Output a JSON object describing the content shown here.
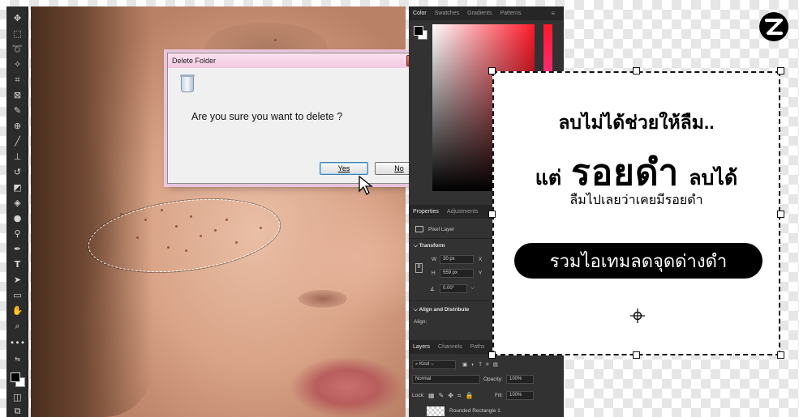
{
  "dialog": {
    "title": "Delete Folder",
    "close": "x",
    "message": "Are you sure you want to delete ?",
    "yes": "Yes",
    "no": "No"
  },
  "color_panel": {
    "tabs": [
      "Color",
      "Swatches",
      "Gradients",
      "Patterns"
    ],
    "menu": "≡"
  },
  "properties_panel": {
    "tabs": [
      "Properties",
      "Adjustments"
    ],
    "layer_type": "Pixel Layer",
    "transform_label": "Transform",
    "w_label": "W",
    "w_value": "30 px",
    "x_label": "X",
    "h_label": "H",
    "h_value": "559 px",
    "y_label": "Y",
    "angle": "0.00°",
    "align_label": "Align and Distribute",
    "align_sub": "Align:"
  },
  "layers_panel": {
    "tabs": [
      "Layers",
      "Channels",
      "Paths"
    ],
    "kind": "Kind",
    "blend_mode": "Normal",
    "opacity_label": "Opacity:",
    "opacity_value": "100%",
    "lock_label": "Lock:",
    "fill_label": "Fill:",
    "fill_value": "100%",
    "layer_name": "Rounded Rectangle 1"
  },
  "card": {
    "line1": "ลบไม่ได้ช่วยให้ลืม..",
    "line2_left": "แต่",
    "line2_big": "รอยดำ",
    "line2_right": "ลบได้",
    "line3": "ลืมไปเลยว่าเคยมีรอยดำ",
    "button": "รวมไอเทมลดจุดด่างดำ"
  },
  "colors": {
    "toolbar": "#2b2b2b",
    "panel": "#323232",
    "pill": "#000000",
    "hue_bar_top": "#ff1a2a"
  },
  "icons": {
    "toolbar": [
      "move-icon",
      "marquee-icon",
      "lasso-icon",
      "magic-wand-icon",
      "crop-icon",
      "frame-icon",
      "eyedropper-icon",
      "healing-icon",
      "brush-icon",
      "stamp-icon",
      "history-brush-icon",
      "eraser-icon",
      "bucket-icon",
      "blur-icon",
      "dodge-icon",
      "pen-icon",
      "type-icon",
      "path-select-icon",
      "shape-icon",
      "hand-icon",
      "zoom-icon",
      "more-icon",
      "swap-colors-icon",
      "quick-mask-icon",
      "screen-mode-icon"
    ]
  }
}
